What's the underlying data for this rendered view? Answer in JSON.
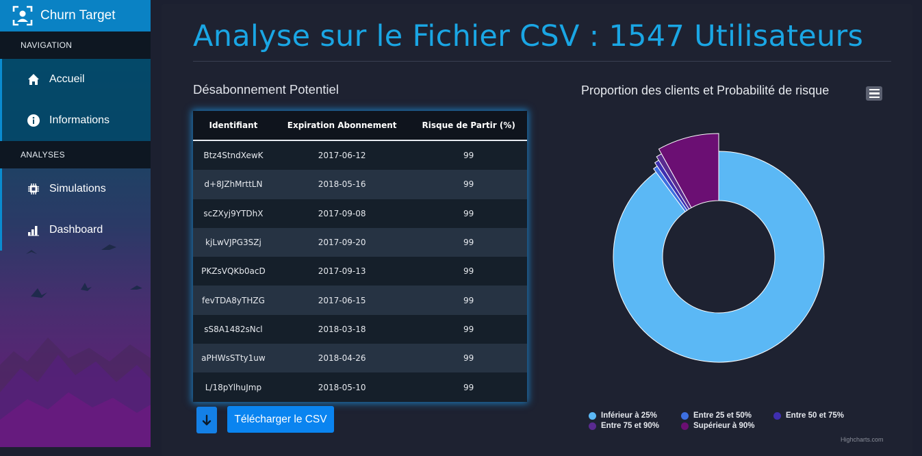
{
  "app": {
    "name": "Churn Target"
  },
  "nav": {
    "section_navigation": "NAVIGATION",
    "section_analyses": "ANALYSES",
    "items": [
      {
        "label": "Accueil",
        "icon": "home-icon"
      },
      {
        "label": "Informations",
        "icon": "info-icon"
      },
      {
        "label": "Simulations",
        "icon": "chip-icon"
      },
      {
        "label": "Dashboard",
        "icon": "bar-chart-icon"
      }
    ]
  },
  "page": {
    "title": "Analyse sur le Fichier CSV : 1547 Utilisateurs",
    "subtitle": "Désabonnement Potentiel"
  },
  "table": {
    "columns": [
      "Identifiant",
      "Expiration Abonnement",
      "Risque de Partir (%)"
    ],
    "rows": [
      [
        "Btz4StndXewK",
        "2017-06-12",
        "99"
      ],
      [
        "d+8JZhMrttLN",
        "2018-05-16",
        "99"
      ],
      [
        "scZXyj9YTDhX",
        "2017-09-08",
        "99"
      ],
      [
        "kjLwVJPG3SZj",
        "2017-09-20",
        "99"
      ],
      [
        "PKZsVQKb0acD",
        "2017-09-13",
        "99"
      ],
      [
        "fevTDA8yTHZG",
        "2017-06-15",
        "99"
      ],
      [
        "sS8A1482sNcl",
        "2018-03-18",
        "99"
      ],
      [
        "aPHWsSTty1uw",
        "2018-04-26",
        "99"
      ],
      [
        "L/18pYlhuJmp",
        "2018-05-10",
        "99"
      ]
    ]
  },
  "download": {
    "label": "Télécharger le CSV",
    "icon": "download-file-icon"
  },
  "chart_data": {
    "type": "pie",
    "title": "Proportion des clients et Probabilité de risque",
    "variant": "variable-radius donut",
    "series": [
      {
        "name": "Inférieur à 25%",
        "value": 1390,
        "color": "#5bb8f5"
      },
      {
        "name": "Entre 25 et 50%",
        "value": 10,
        "color": "#3d6fe0"
      },
      {
        "name": "Entre 50 et 75%",
        "value": 10,
        "color": "#3f2fb0"
      },
      {
        "name": "Entre 75 et 90%",
        "value": 12,
        "color": "#5a2a90"
      },
      {
        "name": "Supérieur à 90%",
        "value": 125,
        "color": "#6b0f73"
      }
    ],
    "legend_position": "bottom",
    "credits": "Highcharts.com"
  },
  "colors": {
    "accent": "#1aa6e4",
    "brand": "#0a82c4",
    "button": "#0a84f0"
  }
}
